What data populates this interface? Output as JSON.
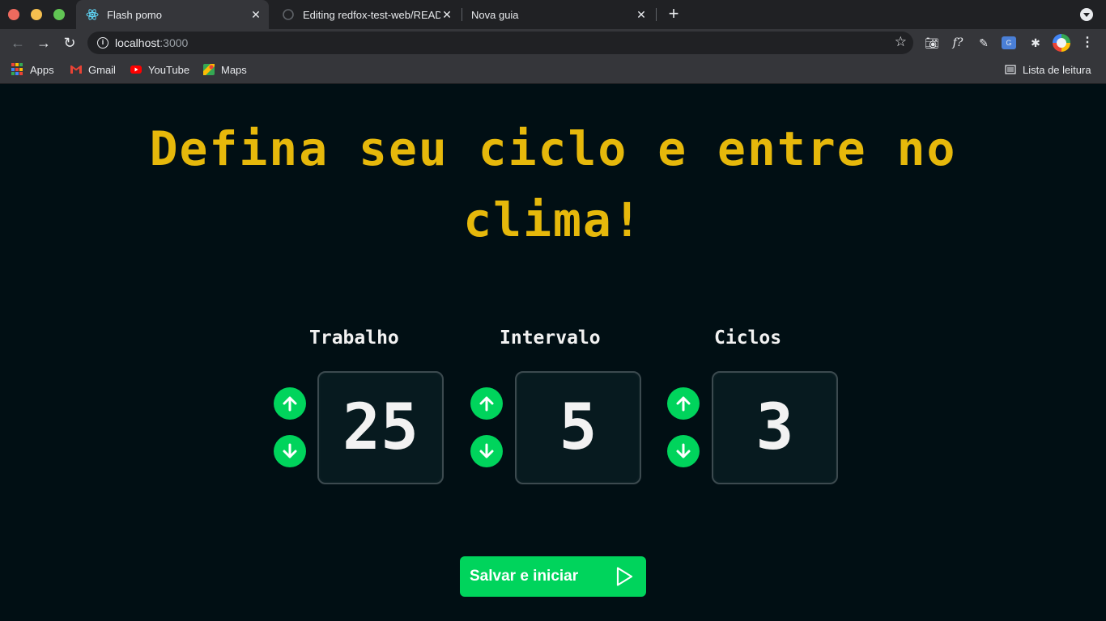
{
  "browser": {
    "tabs": [
      {
        "title": "Flash pomo",
        "active": true
      },
      {
        "title": "Editing redfox-test-web/README.md",
        "active": false
      },
      {
        "title": "Nova guia",
        "active": false
      }
    ],
    "url_host": "localhost",
    "url_port": ":3000",
    "bookmarks": [
      "Apps",
      "Gmail",
      "YouTube",
      "Maps"
    ],
    "reading_list": "Lista de leitura"
  },
  "page": {
    "headline": "Defina seu ciclo e entre no clima!",
    "settings": [
      {
        "label": "Trabalho",
        "value": "25"
      },
      {
        "label": "Intervalo",
        "value": "5"
      },
      {
        "label": "Ciclos",
        "value": "3"
      }
    ],
    "start_button": "Salvar e iniciar"
  },
  "colors": {
    "background": "#010f14",
    "accent_yellow": "#e6b80b",
    "accent_green": "#00d45c"
  }
}
